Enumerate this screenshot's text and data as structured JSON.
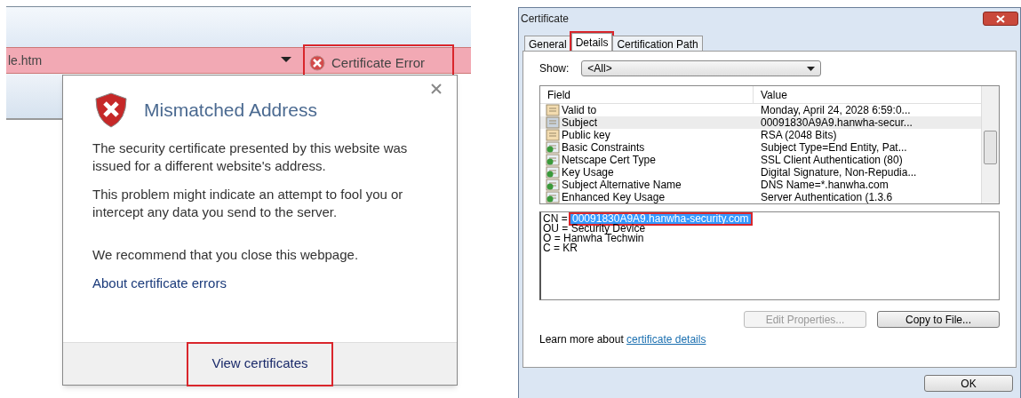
{
  "browser": {
    "address_text": "le.htm",
    "certificate_error": {
      "label": "Certificate Error",
      "highlighted": true
    }
  },
  "popup": {
    "title": "Mismatched Address",
    "paragraphs": [
      "The security certificate presented by this website was issued for a different website's address.",
      "This problem might indicate an attempt to fool you or intercept any data you send to the server.",
      "We recommend that you close this webpage."
    ],
    "link": "About certificate errors",
    "button": {
      "label": "View certificates",
      "highlighted": true
    }
  },
  "dialog": {
    "title": "Certificate",
    "tabs": [
      {
        "label": "General",
        "selected": false,
        "highlighted": false
      },
      {
        "label": "Details",
        "selected": true,
        "highlighted": true
      },
      {
        "label": "Certification Path",
        "selected": false,
        "highlighted": false
      }
    ],
    "show": {
      "label": "Show:",
      "value": "<All>"
    },
    "table": {
      "columns": [
        "Field",
        "Value"
      ],
      "rows": [
        {
          "kind": "property",
          "field": "Valid to",
          "value": "Monday, April 24, 2028 6:59:0...",
          "selected": false
        },
        {
          "kind": "subject",
          "field": "Subject",
          "value": "00091830A9A9.hanwha-secur...",
          "selected": true
        },
        {
          "kind": "property",
          "field": "Public key",
          "value": "RSA (2048 Bits)",
          "selected": false
        },
        {
          "kind": "extension",
          "field": "Basic Constraints",
          "value": "Subject Type=End Entity, Pat...",
          "selected": false
        },
        {
          "kind": "extension",
          "field": "Netscape Cert Type",
          "value": "SSL Client Authentication (80)",
          "selected": false
        },
        {
          "kind": "extension",
          "field": "Key Usage",
          "value": "Digital Signature, Non-Repudia...",
          "selected": false
        },
        {
          "kind": "extension",
          "field": "Subject Alternative Name",
          "value": "DNS Name=*.hanwha.com",
          "selected": false
        },
        {
          "kind": "extension",
          "field": "Enhanced Key Usage",
          "value": "Server Authentication (1.3.6",
          "selected": false
        }
      ]
    },
    "detail_lines": [
      {
        "prefix": "CN = ",
        "value": "00091830A9A9.hanwha-security.com",
        "highlighted": true
      },
      {
        "prefix": "OU = ",
        "value": "Security Device",
        "highlighted": false
      },
      {
        "prefix": "O = ",
        "value": "Hanwha Techwin",
        "highlighted": false
      },
      {
        "prefix": "C = ",
        "value": "KR",
        "highlighted": false
      }
    ],
    "buttons": [
      {
        "label": "Edit Properties...",
        "disabled": true
      },
      {
        "label": "Copy to File...",
        "disabled": false
      }
    ],
    "learn_more": {
      "text": "Learn more about ",
      "link": "certificate details"
    },
    "ok": "OK"
  }
}
